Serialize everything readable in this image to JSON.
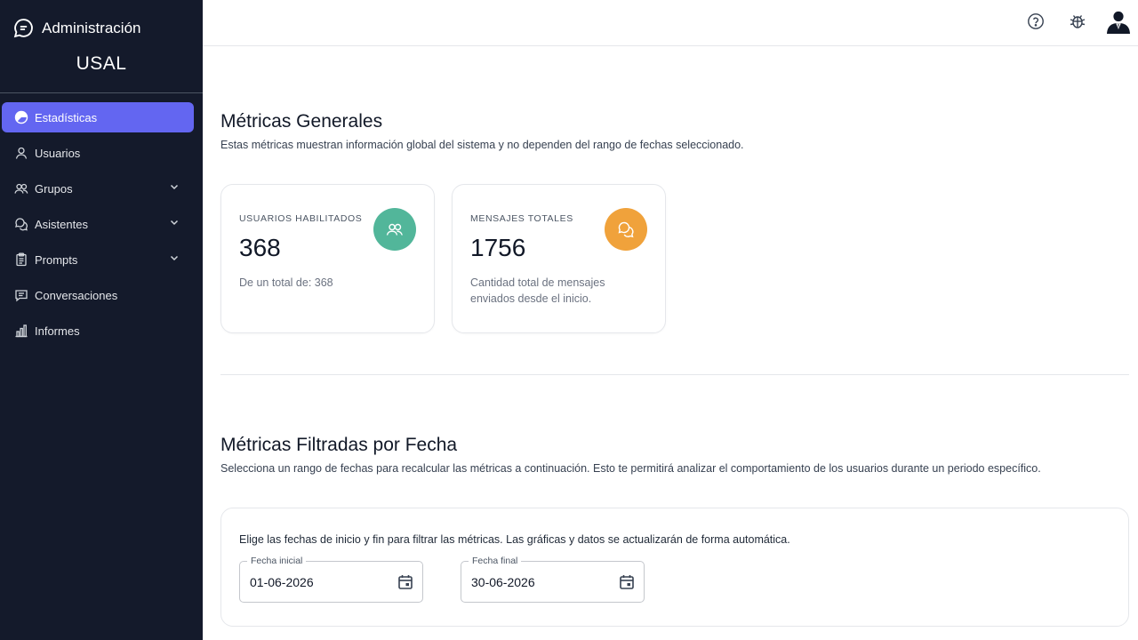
{
  "sidebar": {
    "brand_title": "Administración",
    "org_name": "USAL",
    "items": [
      {
        "label": "Estadísticas",
        "icon": "pie-chart-icon",
        "active": true,
        "expandable": false
      },
      {
        "label": "Usuarios",
        "icon": "user-icon",
        "active": false,
        "expandable": false
      },
      {
        "label": "Grupos",
        "icon": "users-icon",
        "active": false,
        "expandable": true
      },
      {
        "label": "Asistentes",
        "icon": "chat-bubbles-icon",
        "active": false,
        "expandable": true
      },
      {
        "label": "Prompts",
        "icon": "clipboard-icon",
        "active": false,
        "expandable": true
      },
      {
        "label": "Conversaciones",
        "icon": "message-square-icon",
        "active": false,
        "expandable": false
      },
      {
        "label": "Informes",
        "icon": "bar-chart-icon",
        "active": false,
        "expandable": false
      }
    ]
  },
  "topbar": {
    "icons": [
      "help-circle-icon",
      "bug-icon",
      "user-avatar-icon"
    ]
  },
  "general": {
    "title": "Métricas Generales",
    "description": "Estas métricas muestran información global del sistema y no dependen del rango de fechas seleccionado.",
    "cards": [
      {
        "label": "USUARIOS HABILITADOS",
        "value": "368",
        "note": "De un total de: 368",
        "icon": "users-icon",
        "color": "#52b69a"
      },
      {
        "label": "MENSAJES TOTALES",
        "value": "1756",
        "note": "Cantidad total de mensajes enviados desde el inicio.",
        "icon": "chat-bubbles-icon",
        "color": "#f0a23b"
      }
    ]
  },
  "filtered": {
    "title": "Métricas Filtradas por Fecha",
    "description": "Selecciona un rango de fechas para recalcular las métricas a continuación. Esto te permitirá analizar el comportamiento de los usuarios durante un periodo específico.",
    "filter_description": "Elige las fechas de inicio y fin para filtrar las métricas. Las gráficas y datos se actualizarán de forma automática.",
    "start": {
      "label": "Fecha inicial",
      "value": "01-06-2026"
    },
    "end": {
      "label": "Fecha final",
      "value": "30-06-2026"
    }
  },
  "colors": {
    "sidebar_bg": "#141a2b",
    "accent": "#6366f1",
    "green": "#52b69a",
    "orange": "#f0a23b"
  }
}
